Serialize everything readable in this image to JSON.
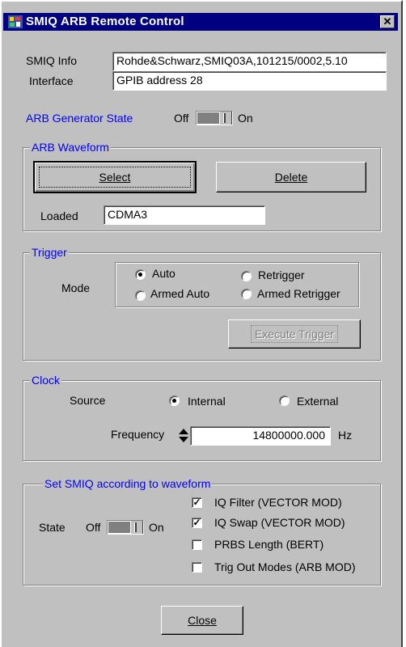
{
  "window": {
    "title": "SMIQ ARB Remote Control",
    "close_glyph": "✕"
  },
  "info": {
    "smiq_info_label": "SMIQ Info",
    "smiq_info_value": "Rohde&Schwarz,SMIQ03A,101215/0002,5.10",
    "interface_label": "Interface",
    "interface_value": "GPIB address 28"
  },
  "arb_state": {
    "label": "ARB Generator State",
    "off_label": "Off",
    "on_label": "On",
    "state": "Off"
  },
  "arb_waveform": {
    "legend": "ARB Waveform",
    "select_label": "Select",
    "delete_label": "Delete",
    "loaded_label": "Loaded",
    "loaded_value": "CDMA3"
  },
  "trigger": {
    "legend": "Trigger",
    "mode_label": "Mode",
    "options": [
      "Auto",
      "Retrigger",
      "Armed Auto",
      "Armed Retrigger"
    ],
    "selected": "Auto",
    "execute_label": "Execute Trigger"
  },
  "clock": {
    "legend": "Clock",
    "source_label": "Source",
    "internal_label": "Internal",
    "external_label": "External",
    "selected": "Internal",
    "frequency_label": "Frequency",
    "frequency_value": "14800000.000",
    "frequency_unit": "Hz"
  },
  "set_smiq": {
    "legend": "Set SMIQ according to waveform",
    "state_label": "State",
    "off_label": "Off",
    "on_label": "On",
    "checkboxes": [
      {
        "label": "IQ Filter (VECTOR MOD)",
        "checked": true
      },
      {
        "label": "IQ Swap (VECTOR MOD)",
        "checked": true
      },
      {
        "label": "PRBS Length (BERT)",
        "checked": false
      },
      {
        "label": "Trig Out Modes (ARB MOD)",
        "checked": false
      }
    ]
  },
  "close_label": "Close",
  "colors": {
    "title_bar": "#000080",
    "legend_text": "#0000ff",
    "face": "#c0c0c0"
  },
  "icons": {
    "app_icon": "app-icon",
    "spinner": "spin-updown-icon"
  }
}
